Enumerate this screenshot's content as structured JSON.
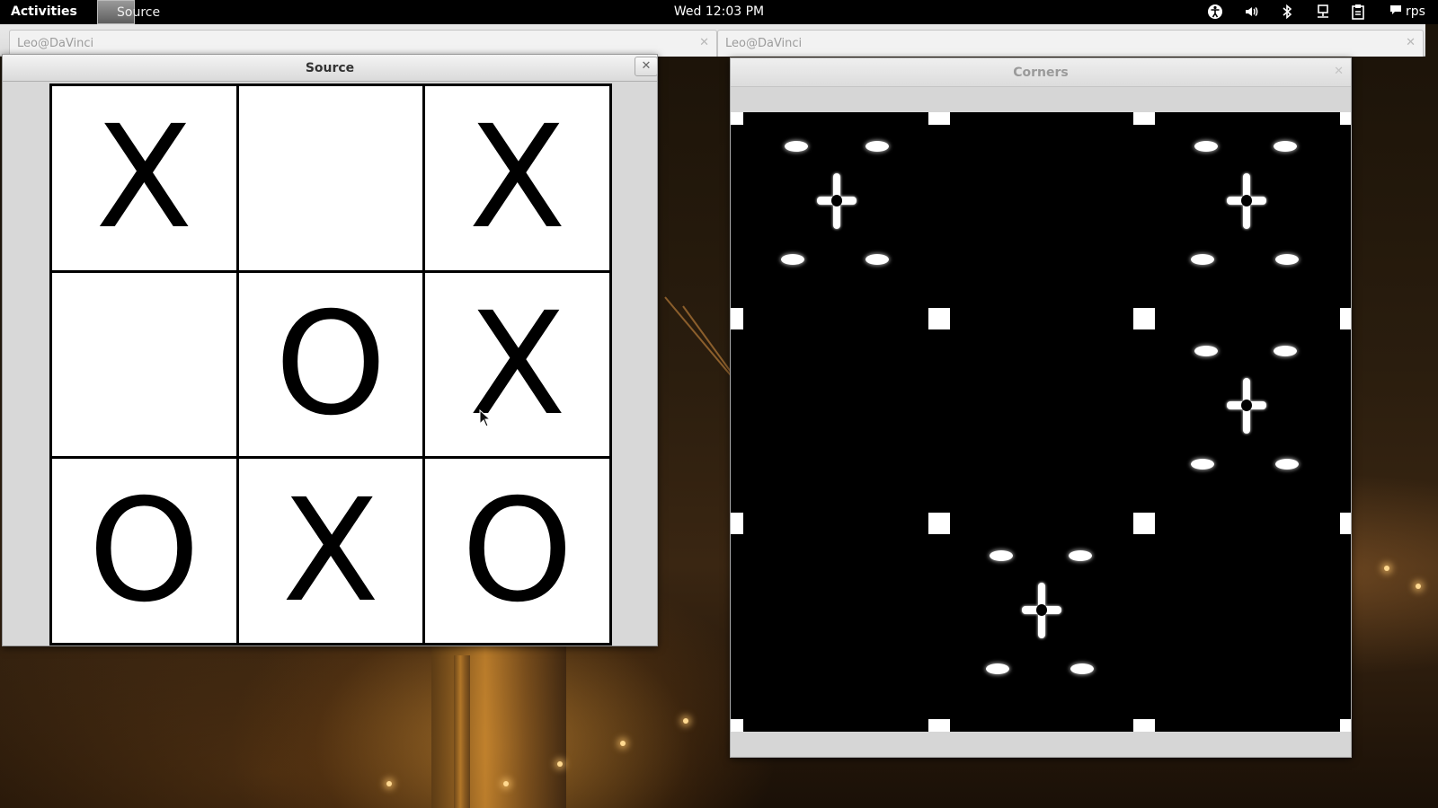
{
  "topbar": {
    "activities_label": "Activities",
    "app_menu_label": "Source",
    "clock": "Wed 12:03 PM",
    "tray_icons": [
      "accessibility-icon",
      "volume-icon",
      "bluetooth-icon",
      "network-icon",
      "clipboard-icon"
    ],
    "user_label": "rps"
  },
  "terminal_tabs": [
    {
      "label": "Leo@DaVinci",
      "close": "✕"
    },
    {
      "label": "Leo@DaVinci",
      "close": "✕"
    }
  ],
  "source_window": {
    "title": "Source",
    "close_glyph": "✕",
    "board": [
      "X",
      "",
      "X",
      "",
      "O",
      "X",
      "O",
      "X",
      "O"
    ]
  },
  "corners_window": {
    "title": "Corners",
    "close_glyph": "✕"
  },
  "colors": {
    "topbar_bg": "#000000",
    "board_line": "#000000",
    "corners_canvas_bg": "#000000",
    "feature_mark": "#ffffff"
  }
}
